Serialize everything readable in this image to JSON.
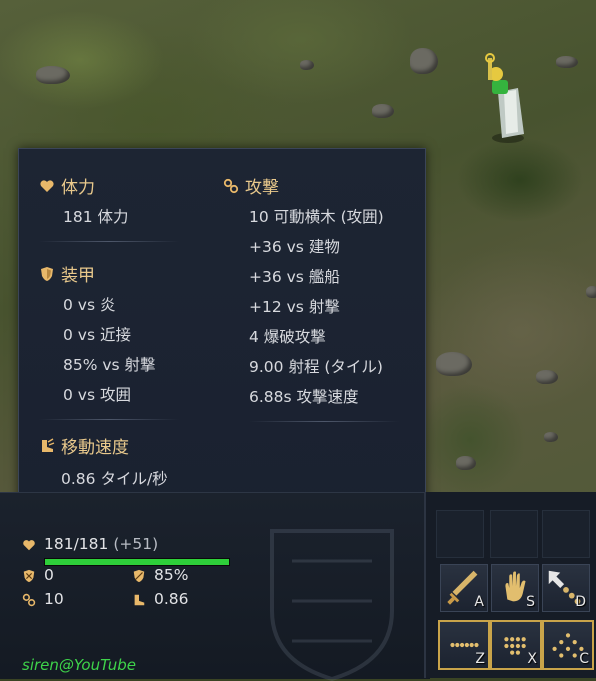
{
  "tooltip": {
    "health": {
      "title": "体力",
      "value": "181 体力",
      "icon": "heart-icon"
    },
    "armor": {
      "title": "装甲",
      "rows": [
        "0 vs 炎",
        "0 vs 近接",
        "85% vs 射撃",
        "0 vs 攻囲"
      ],
      "icon": "shield-icon"
    },
    "speed": {
      "title": "移動速度",
      "value": "0.86 タイル/秒",
      "icon": "boot-icon"
    },
    "attack": {
      "title": "攻撃",
      "rows": [
        "10 可動横木 (攻囲)",
        "+36 vs 建物",
        "+36 vs 艦船",
        "+12 vs 射撃",
        "4 爆破攻撃",
        "9.00 射程 (タイル)",
        "6.88s 攻撃速度"
      ],
      "icon": "attack-icon"
    }
  },
  "hud": {
    "hp_text": "181/181",
    "hp_bonus": "(+51)",
    "hp_fraction": 1.0,
    "armor_melee": "0",
    "armor_ranged": "85%",
    "attack": "10",
    "speed": "0.86",
    "watermark": "siren@YouTube",
    "hp_color": "#2ecf3a"
  },
  "commands": [
    {
      "key": "A",
      "icon": "sword-icon"
    },
    {
      "key": "S",
      "icon": "hand-icon"
    },
    {
      "key": "D",
      "icon": "waypoint-icon"
    },
    {
      "key": "Z",
      "icon": "line-formation-icon"
    },
    {
      "key": "X",
      "icon": "box-formation-icon"
    },
    {
      "key": "C",
      "icon": "spread-formation-icon"
    }
  ],
  "colors": {
    "accent_gold": "#e9c98c",
    "panel_bg": "#1d2533",
    "text": "#d7d9de"
  }
}
